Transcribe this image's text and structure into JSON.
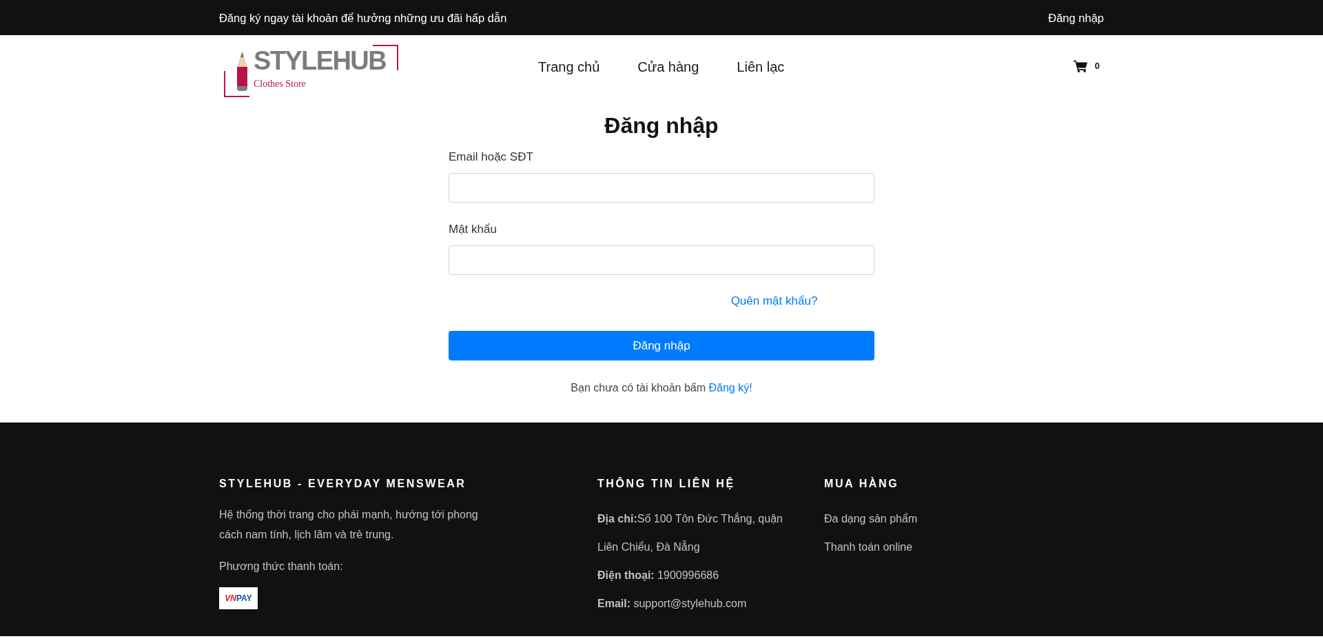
{
  "promo_bar": {
    "message": "Đăng ký ngay tài khoản để hưởng những ưu đãi hấp dẫn",
    "login_link": "Đăng nhập"
  },
  "header": {
    "logo": {
      "name": "STYLEHUB",
      "tagline": "Clothes Store"
    },
    "nav": [
      {
        "label": "Trang chủ"
      },
      {
        "label": "Cửa hàng"
      },
      {
        "label": "Liên lạc"
      }
    ],
    "cart": {
      "count": "0"
    }
  },
  "login_form": {
    "title": "Đăng nhập",
    "fields": [
      {
        "label": "Email hoặc SĐT"
      },
      {
        "label": "Mật khẩu"
      }
    ],
    "forgot_link": "Quên mật khẩu?",
    "submit": "Đăng nhập",
    "signup_prompt": {
      "text": "Bạn chưa có tài khoản bấm",
      "link": "Đăng ký!"
    }
  },
  "footer": {
    "about": {
      "heading": "STYLEHUB - EVERYDAY MENSWEAR",
      "description": "Hệ thống thời trang cho phái mạnh, hướng tới phong cách nam tính, lịch lãm và trẻ trung.",
      "payment_label": "Phương thức thanh toán:",
      "payment_logo": {
        "prefix": "VN",
        "suffix": "PAY"
      }
    },
    "contact": {
      "heading": "THÔNG TIN LIÊN HỆ",
      "lines": [
        "**Địa chỉ:**Số 100 Tôn Đức Thắng, quận Liên Chiểu, Đà Nẵng",
        "**Điện thoại:** 1900996686",
        "**Email:** support@stylehub.com"
      ]
    },
    "shopping": {
      "heading": "MUA HÀNG",
      "links": [
        "Đa dạng sản phẩm",
        "Thanh toán online"
      ]
    }
  }
}
